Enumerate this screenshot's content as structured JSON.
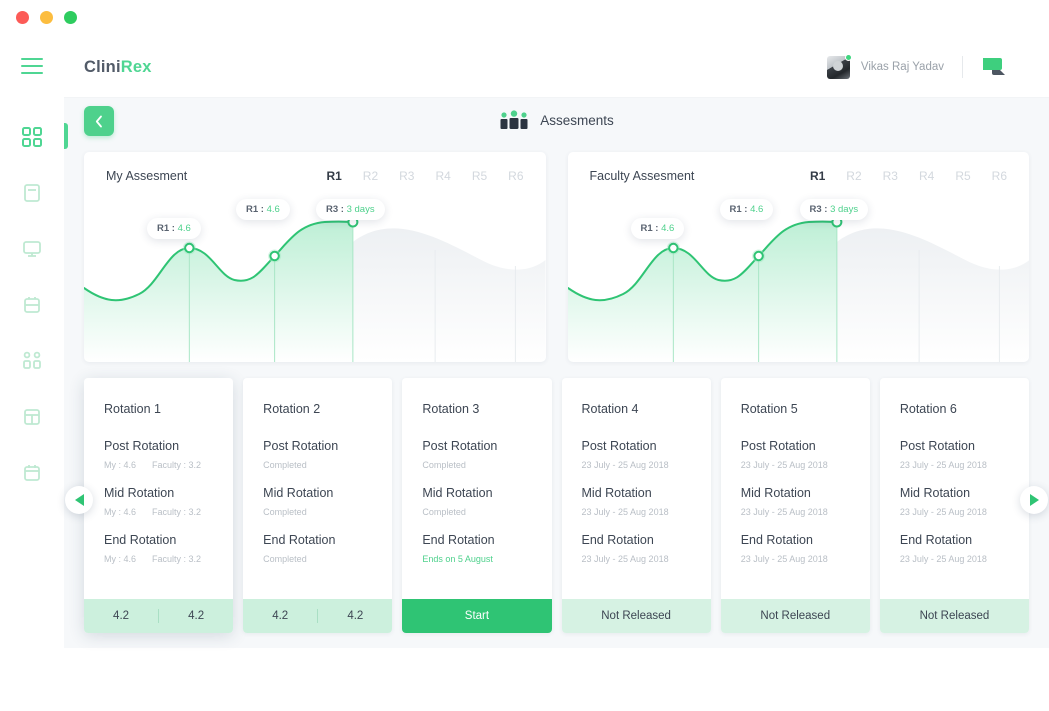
{
  "window": {
    "dots": [
      "close",
      "minimize",
      "maximize"
    ]
  },
  "brand": {
    "part1": "Clini",
    "part2": "Rex"
  },
  "header": {
    "menu_icon": "hamburger-icon",
    "user_name": "Vikas Raj Yadav",
    "chat_icon": "chat-bubble-icon",
    "avatar_status": "online"
  },
  "sidebar": {
    "items": [
      {
        "name": "dashboard",
        "icon": "grid-icon",
        "active": true
      },
      {
        "name": "library",
        "icon": "book-icon",
        "active": false
      },
      {
        "name": "monitor",
        "icon": "monitor-icon",
        "active": false
      },
      {
        "name": "briefcase",
        "icon": "briefcase-icon",
        "active": false
      },
      {
        "name": "network",
        "icon": "people-network-icon",
        "active": false
      },
      {
        "name": "reports",
        "icon": "building-icon",
        "active": false
      },
      {
        "name": "calendar",
        "icon": "calendar-icon",
        "active": false
      }
    ]
  },
  "page": {
    "back_icon": "chevron-left-icon",
    "title": "Assesments",
    "title_icon": "people-group-icon"
  },
  "charts": [
    {
      "title": "My Assesment",
      "tabs": [
        {
          "label": "R1",
          "active": true
        },
        {
          "label": "R2",
          "active": false
        },
        {
          "label": "R3",
          "active": false
        },
        {
          "label": "R4",
          "active": false
        },
        {
          "label": "R5",
          "active": false
        },
        {
          "label": "R6",
          "active": false
        }
      ],
      "tooltips": [
        {
          "label": "R1 :",
          "value": "4.6"
        },
        {
          "label": "R1 :",
          "value": "4.6"
        },
        {
          "label": "R3 :",
          "value": "3 days"
        }
      ]
    },
    {
      "title": "Faculty Assesment",
      "tabs": [
        {
          "label": "R1",
          "active": true
        },
        {
          "label": "R2",
          "active": false
        },
        {
          "label": "R3",
          "active": false
        },
        {
          "label": "R4",
          "active": false
        },
        {
          "label": "R5",
          "active": false
        },
        {
          "label": "R6",
          "active": false
        }
      ],
      "tooltips": [
        {
          "label": "R1 :",
          "value": "4.6"
        },
        {
          "label": "R1 :",
          "value": "4.6"
        },
        {
          "label": "R3 :",
          "value": "3 days"
        }
      ]
    }
  ],
  "chart_data": {
    "type": "area",
    "title": "Assesment progress",
    "series": [
      {
        "name": "My Assesment",
        "x": [
          0,
          1,
          2,
          3,
          4,
          5,
          6,
          7,
          8
        ],
        "values": [
          3.2,
          2.8,
          4.1,
          3.6,
          3.5,
          4.4,
          5.0,
          5.05,
          5.05
        ]
      },
      {
        "name": "Faculty Assesment",
        "x": [
          0,
          1,
          2,
          3,
          4,
          5,
          6,
          7,
          8
        ],
        "values": [
          3.2,
          2.8,
          4.1,
          3.6,
          3.5,
          4.4,
          5.0,
          5.05,
          5.05
        ]
      }
    ],
    "markers": [
      {
        "x": 2,
        "label": "R1 : 4.6"
      },
      {
        "x": 4.6,
        "label": "R1 : 4.6"
      },
      {
        "x": 6.6,
        "label": "R3 : 3 days"
      }
    ],
    "xlabel": "",
    "ylabel": "",
    "grid": true,
    "legend": "none"
  },
  "rotations": [
    {
      "name": "Rotation 1",
      "elevated": true,
      "phases": [
        {
          "label": "Post Rotation",
          "my": "My : 4.6",
          "faculty": "Faculty : 3.2",
          "style": "scores"
        },
        {
          "label": "Mid Rotation",
          "my": "My : 4.6",
          "faculty": "Faculty : 3.2",
          "style": "scores"
        },
        {
          "label": "End Rotation",
          "my": "My : 4.6",
          "faculty": "Faculty : 3.2",
          "style": "scores"
        }
      ],
      "footer": {
        "type": "scores",
        "left": "4.2",
        "right": "4.2"
      }
    },
    {
      "name": "Rotation 2",
      "elevated": false,
      "phases": [
        {
          "label": "Post Rotation",
          "status": "Completed",
          "style": "muted"
        },
        {
          "label": "Mid Rotation",
          "status": "Completed",
          "style": "muted"
        },
        {
          "label": "End Rotation",
          "status": "Completed",
          "style": "muted"
        }
      ],
      "footer": {
        "type": "scores",
        "left": "4.2",
        "right": "4.2"
      }
    },
    {
      "name": "Rotation 3",
      "elevated": false,
      "phases": [
        {
          "label": "Post Rotation",
          "status": "Completed",
          "style": "muted"
        },
        {
          "label": "Mid Rotation",
          "status": "Completed",
          "style": "muted"
        },
        {
          "label": "End Rotation",
          "status": "Ends on 5 August",
          "style": "green"
        }
      ],
      "footer": {
        "type": "primary",
        "label": "Start"
      }
    },
    {
      "name": "Rotation 4",
      "elevated": false,
      "phases": [
        {
          "label": "Post Rotation",
          "status": "23 July - 25 Aug 2018",
          "style": "muted"
        },
        {
          "label": "Mid Rotation",
          "status": "23 July - 25 Aug 2018",
          "style": "muted"
        },
        {
          "label": "End Rotation",
          "status": "23 July - 25 Aug 2018",
          "style": "muted"
        }
      ],
      "footer": {
        "type": "status",
        "label": "Not Released"
      }
    },
    {
      "name": "Rotation 5",
      "elevated": false,
      "phases": [
        {
          "label": "Post Rotation",
          "status": "23 July - 25 Aug 2018",
          "style": "muted"
        },
        {
          "label": "Mid Rotation",
          "status": "23 July - 25 Aug 2018",
          "style": "muted"
        },
        {
          "label": "End Rotation",
          "status": "23 July - 25 Aug 2018",
          "style": "muted"
        }
      ],
      "footer": {
        "type": "status",
        "label": "Not Released"
      }
    },
    {
      "name": "Rotation 6",
      "elevated": false,
      "phases": [
        {
          "label": "Post Rotation",
          "status": "23 July - 25 Aug 2018",
          "style": "muted"
        },
        {
          "label": "Mid Rotation",
          "status": "23 July - 25 Aug 2018",
          "style": "muted"
        },
        {
          "label": "End Rotation",
          "status": "23 July - 25 Aug 2018",
          "style": "muted"
        }
      ],
      "footer": {
        "type": "status",
        "label": "Not Released"
      }
    }
  ],
  "carousel": {
    "prev_icon": "triangle-left-icon",
    "next_icon": "triangle-right-icon"
  },
  "colors": {
    "accent": "#2fc474",
    "accent_light": "#4ed18c",
    "mint": "#ccf0dd",
    "panel_bg": "#f6f8fa",
    "text": "#3d4653",
    "muted": "#b9bfc6"
  }
}
